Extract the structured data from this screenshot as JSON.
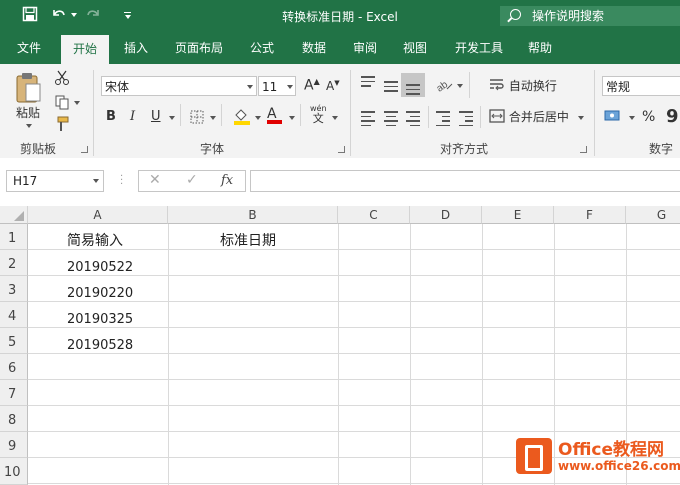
{
  "window": {
    "title": "转换标准日期  -  Excel"
  },
  "tell_me": {
    "placeholder": "操作说明搜索"
  },
  "tabs": [
    "文件",
    "开始",
    "插入",
    "页面布局",
    "公式",
    "数据",
    "审阅",
    "视图",
    "开发工具",
    "帮助"
  ],
  "active_tab": "开始",
  "ribbon": {
    "clipboard": {
      "paste_label": "粘贴",
      "group_label": "剪贴板"
    },
    "font": {
      "font_name": "宋体",
      "font_size": "11",
      "bold": "B",
      "italic": "I",
      "underline": "U",
      "grow": "A",
      "shrink": "A",
      "font_color_letter": "A",
      "wen": "wén",
      "wen_char": "文",
      "group_label": "字体"
    },
    "alignment": {
      "wrap_text": "自动换行",
      "merge_center": "合并后居中",
      "group_label": "对齐方式"
    },
    "number": {
      "format": "常规",
      "percent": "%",
      "comma": "9",
      "group_label": "数字"
    }
  },
  "formula_bar": {
    "name_box": "H17",
    "cancel": "✕",
    "confirm": "✓",
    "fx": "fx",
    "value": ""
  },
  "sheet": {
    "columns": [
      "A",
      "B",
      "C",
      "D",
      "E",
      "F",
      "G"
    ],
    "rows": [
      "1",
      "2",
      "3",
      "4",
      "5",
      "6",
      "7",
      "8",
      "9",
      "10"
    ],
    "cells": {
      "A1": "简易输入",
      "B1": "标准日期",
      "A2": "20190522",
      "A3": "20190220",
      "A4": "20190325",
      "A5": "20190528"
    }
  },
  "watermark": {
    "brand": "Office教程网",
    "url": "www.office26.com"
  },
  "colors": {
    "accent": "#217346",
    "watermark": "#eb5a1e"
  }
}
